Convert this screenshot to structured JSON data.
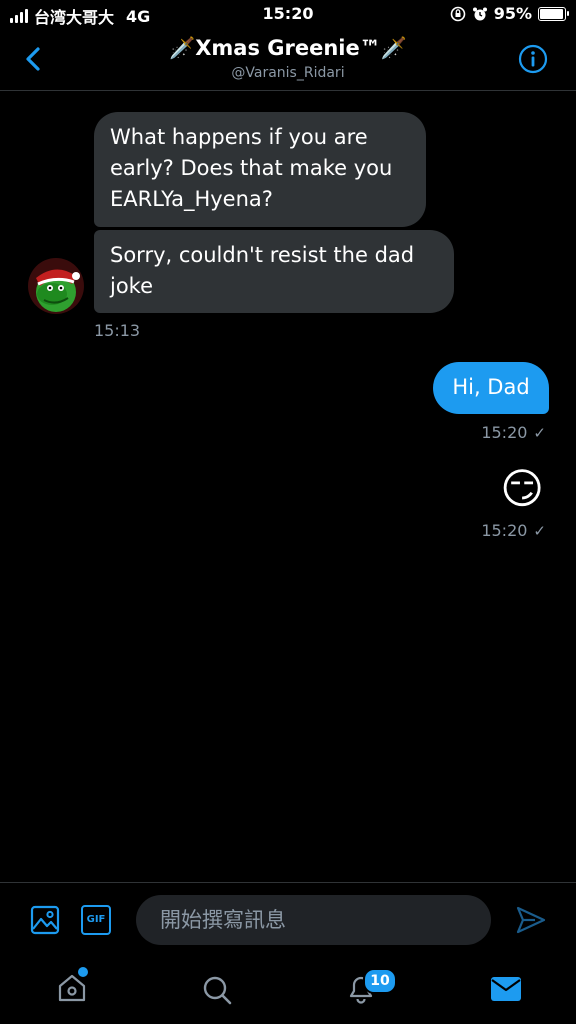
{
  "status_bar": {
    "carrier": "台湾大哥大",
    "network": "4G",
    "time": "15:20",
    "battery": "95%",
    "battery_level": 0.95
  },
  "header": {
    "title": "†Xmas Greenie™†",
    "title_display": "🗡️Xmas Greenie™🗡️",
    "handle": "@Varanis_Ridari"
  },
  "messages": {
    "incoming": [
      {
        "text": "What happens if you are early? Does that make you EARLYa_Hyena?"
      },
      {
        "text": "Sorry, couldn't resist the dad joke"
      }
    ],
    "incoming_time": "15:13",
    "outgoing_text": "Hi, Dad",
    "outgoing_time": "15:20",
    "outgoing_emoji": "😏",
    "emoji_time": "15:20"
  },
  "composer": {
    "placeholder": "開始撰寫訊息",
    "gif_label": "GIF"
  },
  "tabbar": {
    "notifications_count": "10"
  },
  "colors": {
    "accent": "#1d9bf0",
    "bubble_in": "#2f3336",
    "muted": "#8b98a5",
    "background": "#000000"
  }
}
